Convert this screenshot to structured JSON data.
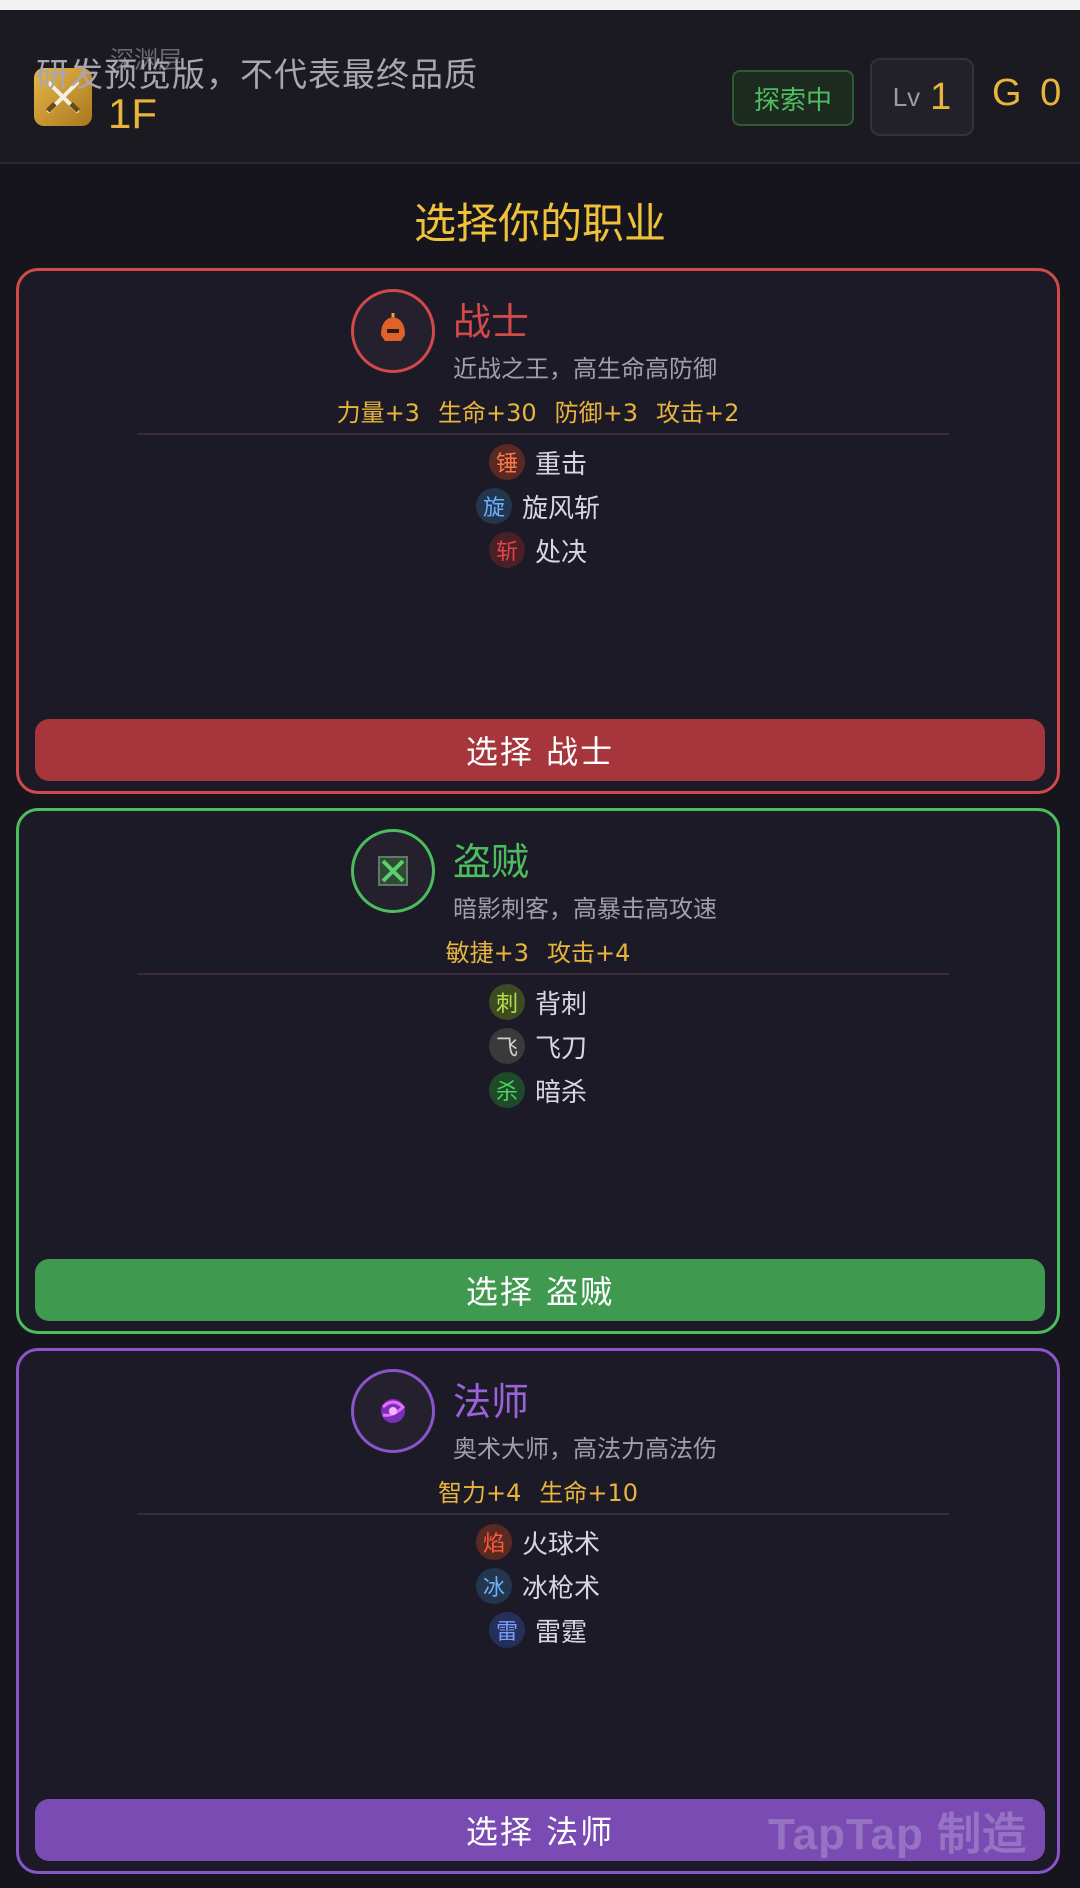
{
  "header": {
    "dev_banner": "研发预览版，不代表最终品质",
    "floor_sub": "深渊层",
    "floor_value": "1F",
    "status_badge": "探索中",
    "level_label": "Lv",
    "level_value": "1",
    "gold": "G 0"
  },
  "page_title": "选择你的职业",
  "classes": [
    {
      "name": "战士",
      "desc": "近战之王，高生命高防御",
      "stats": [
        "力量+3",
        "生命+30",
        "防御+3",
        "攻击+2"
      ],
      "skills": [
        {
          "badge": "锤",
          "name": "重击"
        },
        {
          "badge": "旋",
          "name": "旋风斩"
        },
        {
          "badge": "斩",
          "name": "处决"
        }
      ],
      "button": "选择 战士",
      "color": "#d04a4a",
      "button_color": "#a6363b",
      "icon": "warrior-helmet-icon"
    },
    {
      "name": "盗贼",
      "desc": "暗影刺客，高暴击高攻速",
      "stats": [
        "敏捷+3",
        "攻击+4"
      ],
      "skills": [
        {
          "badge": "刺",
          "name": "背刺"
        },
        {
          "badge": "飞",
          "name": "飞刀"
        },
        {
          "badge": "杀",
          "name": "暗杀"
        }
      ],
      "button": "选择 盗贼",
      "color": "#4cbd5c",
      "button_color": "#3f9a4f",
      "icon": "crossed-daggers-icon"
    },
    {
      "name": "法师",
      "desc": "奥术大师，高法力高法伤",
      "stats": [
        "智力+4",
        "生命+10"
      ],
      "skills": [
        {
          "badge": "焰",
          "name": "火球术"
        },
        {
          "badge": "冰",
          "name": "冰枪术"
        },
        {
          "badge": "雷",
          "name": "雷霆"
        }
      ],
      "button": "选择 法师",
      "color": "#8a55c8",
      "button_color": "#7a4cb3",
      "icon": "arcane-orb-icon"
    }
  ],
  "watermark": "TapTap 制造"
}
